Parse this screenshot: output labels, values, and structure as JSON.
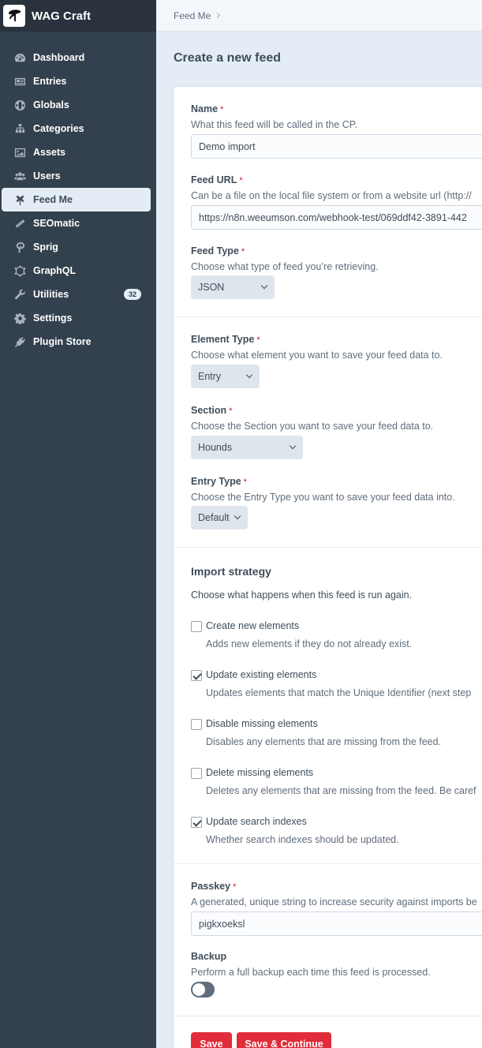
{
  "site": {
    "name": "WAG Craft"
  },
  "nav": [
    {
      "label": "Dashboard",
      "icon": "gauge-icon"
    },
    {
      "label": "Entries",
      "icon": "newspaper-icon"
    },
    {
      "label": "Globals",
      "icon": "globe-icon"
    },
    {
      "label": "Categories",
      "icon": "sitemap-icon"
    },
    {
      "label": "Assets",
      "icon": "image-icon"
    },
    {
      "label": "Users",
      "icon": "users-icon"
    },
    {
      "label": "Feed Me",
      "icon": "feedme-icon"
    },
    {
      "label": "SEOmatic",
      "icon": "seomatic-icon"
    },
    {
      "label": "Sprig",
      "icon": "sprig-icon"
    },
    {
      "label": "GraphQL",
      "icon": "graphql-icon"
    },
    {
      "label": "Utilities",
      "icon": "wrench-icon",
      "badge": "32"
    },
    {
      "label": "Settings",
      "icon": "gear-icon"
    },
    {
      "label": "Plugin Store",
      "icon": "plug-icon"
    }
  ],
  "breadcrumb": {
    "item": "Feed Me"
  },
  "page": {
    "title": "Create a new feed"
  },
  "form": {
    "name": {
      "label": "Name",
      "instructions": "What this feed will be called in the CP.",
      "value": "Demo import"
    },
    "feed_url": {
      "label": "Feed URL",
      "instructions": "Can be a file on the local file system or from a website url (http://",
      "value": "https://n8n.weeumson.com/webhook-test/069ddf42-3891-442"
    },
    "feed_type": {
      "label": "Feed Type",
      "instructions": "Choose what type of feed you’re retrieving.",
      "value": "JSON"
    },
    "element_type": {
      "label": "Element Type",
      "instructions": "Choose what element you want to save your feed data to.",
      "value": "Entry"
    },
    "section": {
      "label": "Section",
      "instructions": "Choose the Section you want to save your feed data to.",
      "value": "Hounds"
    },
    "entry_type": {
      "label": "Entry Type",
      "instructions": "Choose the Entry Type you want to save your feed data into.",
      "value": "Default"
    },
    "import_strategy": {
      "heading": "Import strategy",
      "instructions": "Choose what happens when this feed is run again.",
      "options": [
        {
          "label": "Create new elements",
          "desc": "Adds new elements if they do not already exist.",
          "checked": false
        },
        {
          "label": "Update existing elements",
          "desc": "Updates elements that match the Unique Identifier (next step",
          "checked": true
        },
        {
          "label": "Disable missing elements",
          "desc": "Disables any elements that are missing from the feed.",
          "checked": false
        },
        {
          "label": "Delete missing elements",
          "desc": "Deletes any elements that are missing from the feed. Be caref",
          "checked": false
        },
        {
          "label": "Update search indexes",
          "desc": "Whether search indexes should be updated.",
          "checked": true
        }
      ]
    },
    "passkey": {
      "label": "Passkey",
      "instructions": "A generated, unique string to increase security against imports be",
      "value": "pigkxoeksl"
    },
    "backup": {
      "label": "Backup",
      "instructions": "Perform a full backup each time this feed is processed.",
      "enabled": false
    }
  },
  "actions": {
    "save": "Save",
    "save_continue": "Save & Continue"
  },
  "required_mark": "*"
}
